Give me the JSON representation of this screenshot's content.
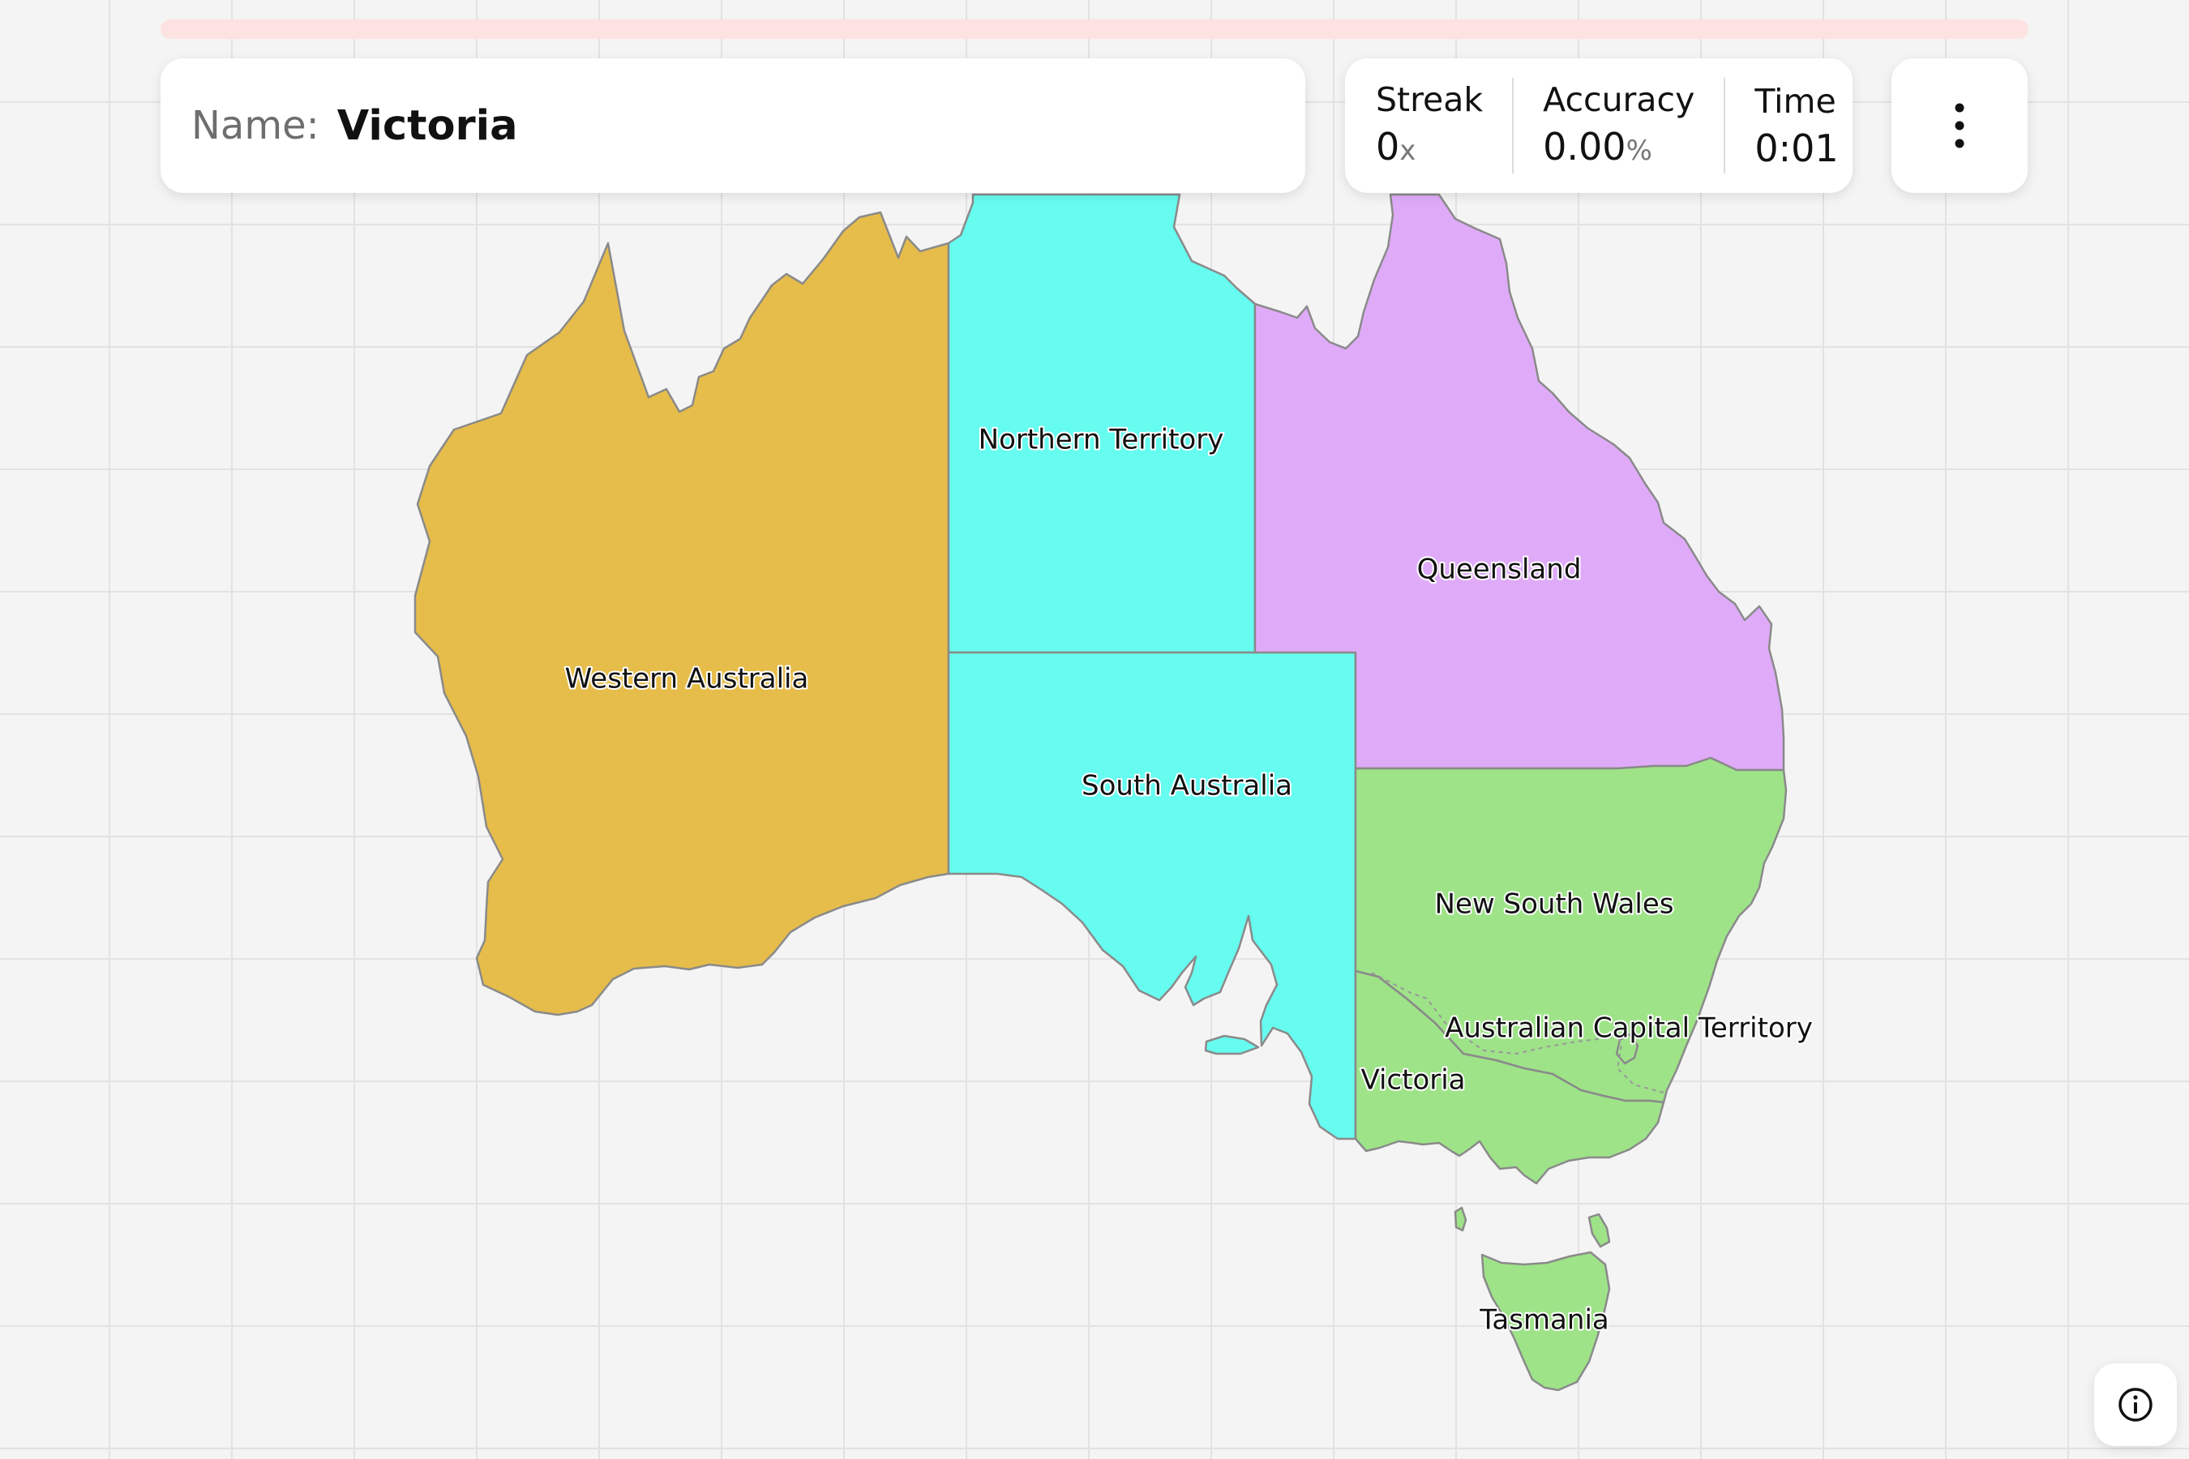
{
  "quiz": {
    "name_label": "Name:",
    "target_name": "Victoria",
    "progress": 0
  },
  "stats": {
    "streak_label": "Streak",
    "streak_value": "0",
    "streak_unit": "x",
    "accuracy_label": "Accuracy",
    "accuracy_value": "0.00",
    "accuracy_unit": "%",
    "time_label": "Time",
    "time_value": "0:01"
  },
  "icons": {
    "menu": "more-vertical-icon",
    "info": "info-icon"
  },
  "map": {
    "regions": [
      {
        "id": "western-australia",
        "label": "Western Australia",
        "color": "#e6bd4a"
      },
      {
        "id": "northern-territory",
        "label": "Northern Territory",
        "color": "#66fcf0"
      },
      {
        "id": "south-australia",
        "label": "South Australia",
        "color": "#66fcf0"
      },
      {
        "id": "queensland",
        "label": "Queensland",
        "color": "#dfabf9"
      },
      {
        "id": "new-south-wales",
        "label": "New South Wales",
        "color": "#9ee388"
      },
      {
        "id": "australian-capital-territory",
        "label": "Australian Capital Territory",
        "color": "#9ee388"
      },
      {
        "id": "victoria",
        "label": "Victoria",
        "color": "#9ee388"
      },
      {
        "id": "tasmania",
        "label": "Tasmania",
        "color": "#9ee388"
      }
    ]
  }
}
